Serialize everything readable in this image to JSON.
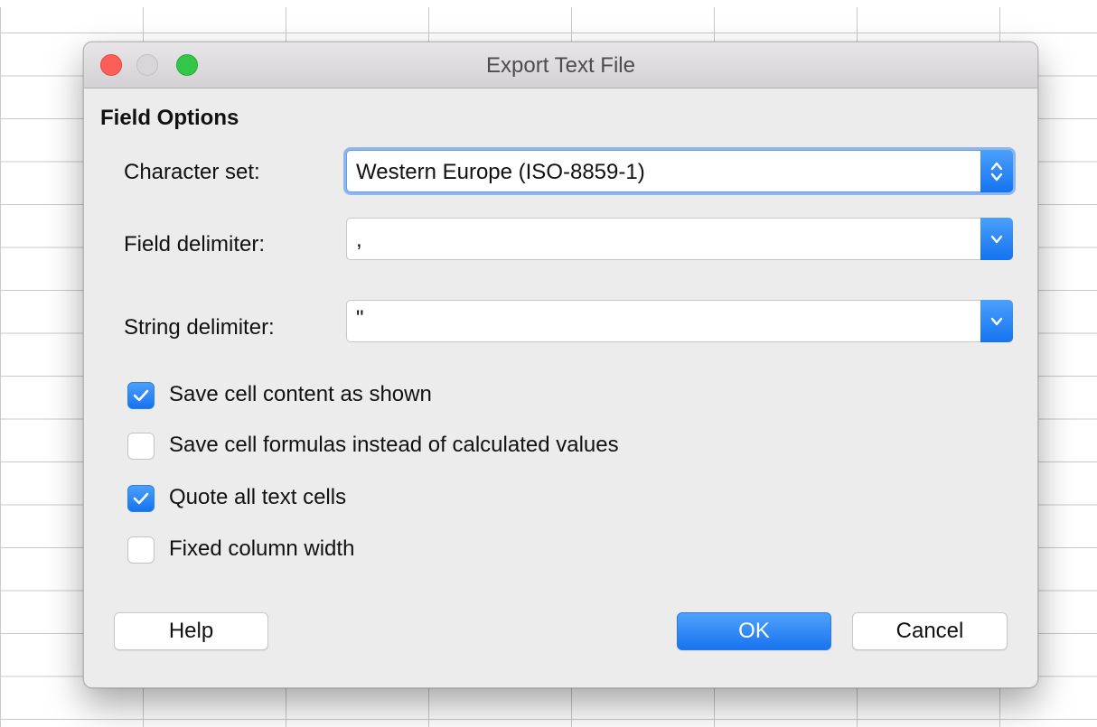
{
  "window": {
    "title": "Export Text File"
  },
  "section": {
    "title": "Field Options"
  },
  "fields": {
    "charset": {
      "label": "Character set:",
      "value": "Western Europe (ISO-8859-1)",
      "icon": "up-down-chevron-icon"
    },
    "field_delimiter": {
      "label": "Field delimiter:",
      "value": ",",
      "icon": "chevron-down-icon"
    },
    "string_delimiter": {
      "label": "String delimiter:",
      "value": "\"",
      "icon": "chevron-down-icon"
    }
  },
  "options": [
    {
      "label": "Save cell content as shown",
      "checked": true
    },
    {
      "label": "Save cell formulas instead of calculated values",
      "checked": false
    },
    {
      "label": "Quote all text cells",
      "checked": true
    },
    {
      "label": "Fixed column width",
      "checked": false
    }
  ],
  "buttons": {
    "help": "Help",
    "ok": "OK",
    "cancel": "Cancel"
  },
  "colors": {
    "accent": "#1e78f0",
    "close": "#fc5f57",
    "maximize": "#33c748"
  }
}
